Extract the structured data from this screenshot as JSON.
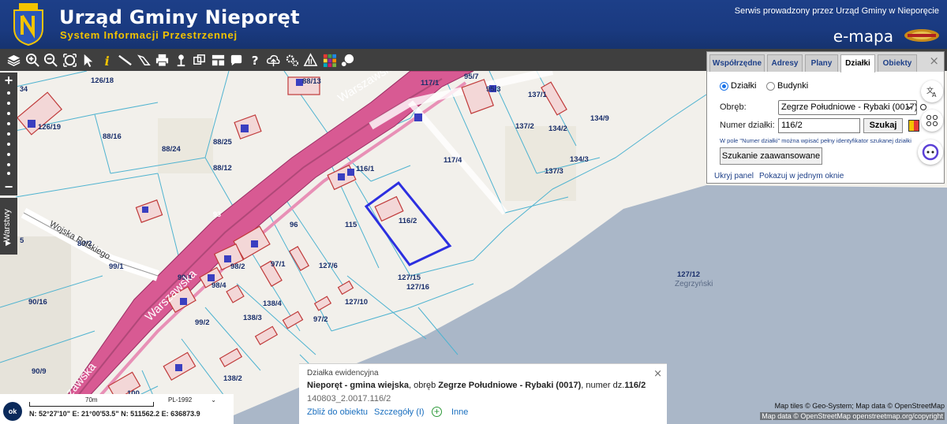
{
  "header": {
    "title": "Urząd Gminy Nieporęt",
    "subtitle": "System Informacji Przestrzennej",
    "service_text": "Serwis prowadzony przez Urząd Gminy w Nieporęcie",
    "brand": "e-mapa",
    "colors": {
      "header_bg": "#1d3f88",
      "subtitle": "#f2c300",
      "toolbar": "#3f3f3f"
    }
  },
  "toolbar": {
    "icons": [
      "layers-icon",
      "zoom-in-icon",
      "zoom-out-icon",
      "zoom-extent-icon",
      "select-arrow-icon",
      "info-icon",
      "measure-distance-icon",
      "measure-area-icon",
      "print-icon",
      "pin-icon",
      "transform-icon",
      "layout-icon",
      "comment-icon",
      "help-icon",
      "upload-icon",
      "settings-icon",
      "warning-icon",
      "color-grid-icon",
      "chat-icon"
    ]
  },
  "sidebar": {
    "zoom_in": "+",
    "zoom_out": "−",
    "layers_label": "Warstwy"
  },
  "panel": {
    "tabs": [
      "Współrzędne",
      "Adresy",
      "Plany",
      "Działki",
      "Obiekty"
    ],
    "active_tab": "Działki",
    "radio_dzialki": "Działki",
    "radio_budynki": "Budynki",
    "obreb_label": "Obręb:",
    "obreb_value": "Zegrze Południowe - Rybaki (0017)",
    "numer_label": "Numer działki:",
    "numer_value": "116/2",
    "search_button": "Szukaj",
    "hint": "W pole \"Numer działki\" można wpisać pełny identyfikator szukanej działki",
    "advanced_button": "Szukanie zaawansowane",
    "hide_link": "Ukryj panel",
    "show_one_link": "Pokazuj w jednym oknie",
    "close": "⨯"
  },
  "map": {
    "street_labels": [
      "Warszawska",
      "Warszawska",
      "Warszawska",
      "Wojska Polskiego"
    ],
    "road_number": "93",
    "water_label": "Zegrzyński",
    "selected_parcel": "116/2",
    "parcel_labels": [
      "126/18",
      "126/19",
      "88/16",
      "88/24",
      "88/25",
      "88/13",
      "88/12",
      "117/1",
      "95/7",
      "95/3",
      "137/1",
      "137/2",
      "134/2",
      "134/9",
      "134/3",
      "137/3",
      "117/4",
      "116/1",
      "116/2",
      "96",
      "115",
      "89/2",
      "99/1",
      "98/2",
      "97/1",
      "127/6",
      "127/15",
      "127/16",
      "127/12",
      "99/1",
      "98/4",
      "138/4",
      "127/10",
      "90/16",
      "99/2",
      "138/3",
      "97/2",
      "90/9",
      "138/2",
      "100",
      "5"
    ]
  },
  "info": {
    "heading": "Działka ewidencyjna",
    "gmina": "Nieporęt - gmina wiejska",
    "obreb_text": ", obręb ",
    "obreb": "Zegrze Południowe - Rybaki (0017)",
    "numer_text": ", numer dz.",
    "numer": "116/2",
    "identifier": "140803_2.0017.116/2",
    "zoom_link": "Zbliż do obiektu",
    "details_link": "Szczegóły (I)",
    "more_link": "Inne",
    "close": "⨯"
  },
  "coords": {
    "ok": "ok",
    "scale": "70m",
    "crs": "PL-1992",
    "text": "N: 52°27'10\"  E: 21°00'53.5\"  N: 511562.2  E: 636873.9"
  },
  "attribution": {
    "line1": "Map tiles © Geo-System; Map data © OpenStreetMap",
    "line2": "Map data © OpenStreetMap openstreetmap.org/copyright"
  }
}
